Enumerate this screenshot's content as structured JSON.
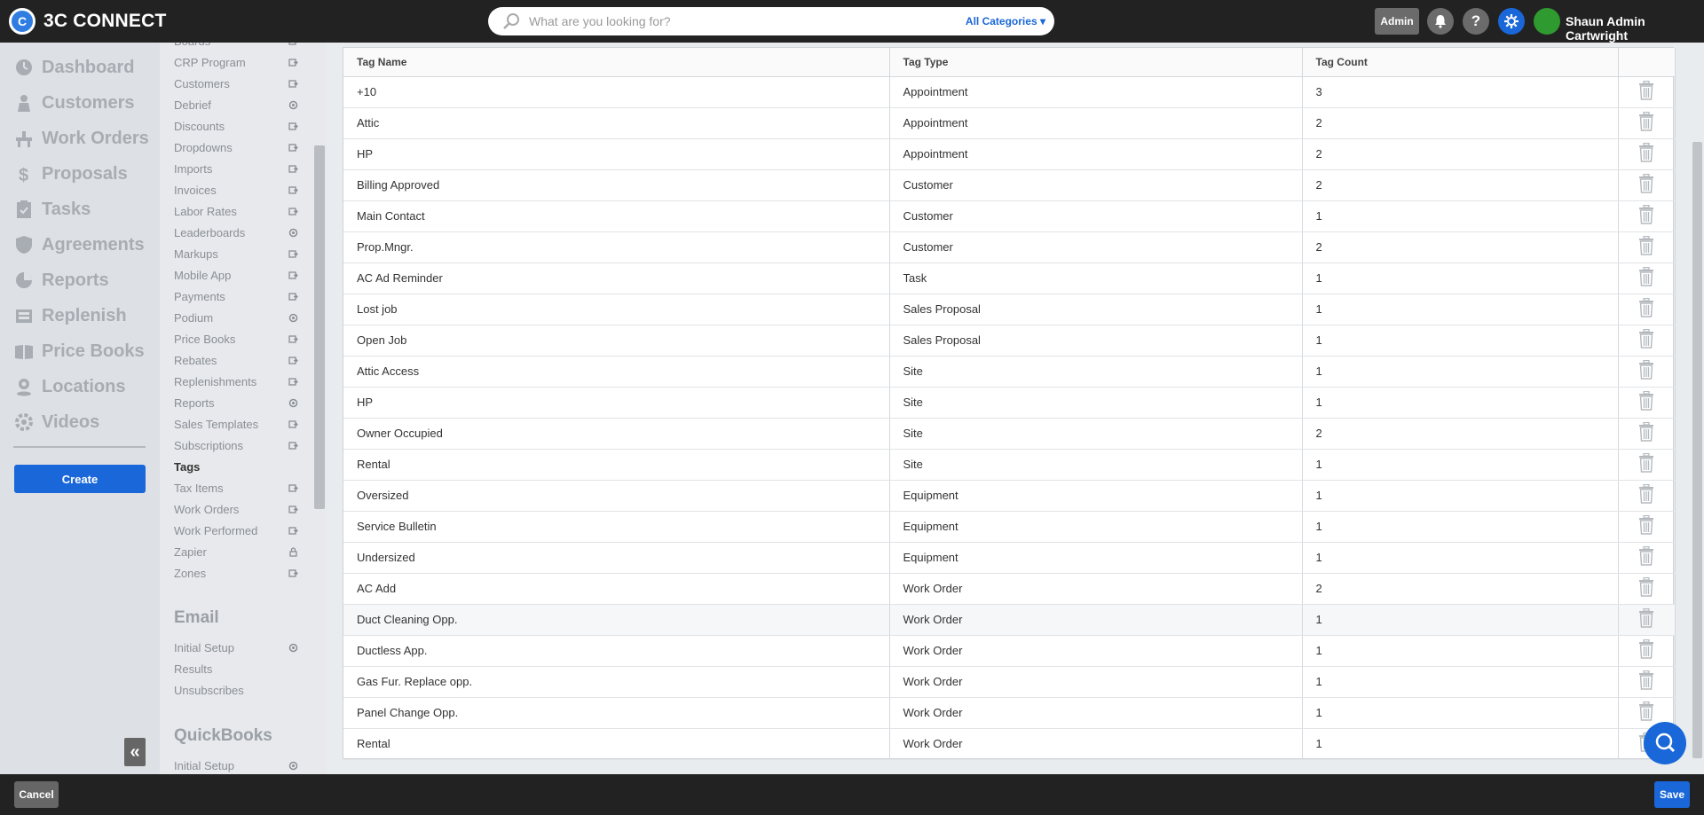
{
  "app": {
    "name": "3C CONNECT"
  },
  "search": {
    "placeholder": "What are you looking for?",
    "category": "All Categories"
  },
  "header": {
    "admin_label": "Admin",
    "help_label": "?",
    "user_name": "Shaun Admin Cartwright"
  },
  "nav": {
    "items": [
      {
        "label": "Dashboard",
        "icon": "dashboard-icon"
      },
      {
        "label": "Customers",
        "icon": "customers-icon"
      },
      {
        "label": "Work Orders",
        "icon": "work-orders-icon"
      },
      {
        "label": "Proposals",
        "icon": "proposals-icon"
      },
      {
        "label": "Tasks",
        "icon": "tasks-icon"
      },
      {
        "label": "Agreements",
        "icon": "agreements-icon"
      },
      {
        "label": "Reports",
        "icon": "reports-icon"
      },
      {
        "label": "Replenish",
        "icon": "replenish-icon"
      },
      {
        "label": "Price Books",
        "icon": "price-books-icon"
      },
      {
        "label": "Locations",
        "icon": "locations-icon"
      },
      {
        "label": "Videos",
        "icon": "videos-icon"
      }
    ],
    "create_label": "Create"
  },
  "subnav": {
    "items": [
      "Boards",
      "CRP Program",
      "Customers",
      "Debrief",
      "Discounts",
      "Dropdowns",
      "Imports",
      "Invoices",
      "Labor Rates",
      "Leaderboards",
      "Markups",
      "Mobile App",
      "Payments",
      "Podium",
      "Price Books",
      "Rebates",
      "Replenishments",
      "Reports",
      "Sales Templates",
      "Subscriptions",
      "Tags",
      "Tax Items",
      "Work Orders",
      "Work Performed",
      "Zapier",
      "Zones"
    ],
    "active": "Tags",
    "email_heading": "Email",
    "email_items": [
      "Initial Setup",
      "Results",
      "Unsubscribes"
    ],
    "quickbooks_heading": "QuickBooks",
    "quickbooks_items": [
      "Initial Setup"
    ]
  },
  "table": {
    "headers": [
      "Tag Name",
      "Tag Type",
      "Tag Count"
    ],
    "rows": [
      [
        "+10",
        "Appointment",
        "3"
      ],
      [
        "Attic",
        "Appointment",
        "2"
      ],
      [
        "HP",
        "Appointment",
        "2"
      ],
      [
        "Billing Approved",
        "Customer",
        "2"
      ],
      [
        "Main Contact",
        "Customer",
        "1"
      ],
      [
        "Prop.Mngr.",
        "Customer",
        "2"
      ],
      [
        "AC Ad Reminder",
        "Task",
        "1"
      ],
      [
        "Lost job",
        "Sales Proposal",
        "1"
      ],
      [
        "Open Job",
        "Sales Proposal",
        "1"
      ],
      [
        "Attic Access",
        "Site",
        "1"
      ],
      [
        "HP",
        "Site",
        "1"
      ],
      [
        "Owner Occupied",
        "Site",
        "2"
      ],
      [
        "Rental",
        "Site",
        "1"
      ],
      [
        "Oversized",
        "Equipment",
        "1"
      ],
      [
        "Service Bulletin",
        "Equipment",
        "1"
      ],
      [
        "Undersized",
        "Equipment",
        "1"
      ],
      [
        "AC Add",
        "Work Order",
        "2"
      ],
      [
        "Duct Cleaning Opp.",
        "Work Order",
        "1"
      ],
      [
        "Ductless App.",
        "Work Order",
        "1"
      ],
      [
        "Gas Fur. Replace opp.",
        "Work Order",
        "1"
      ],
      [
        "Panel Change Opp.",
        "Work Order",
        "1"
      ],
      [
        "Rental",
        "Work Order",
        "1"
      ]
    ]
  },
  "footer": {
    "cancel_label": "Cancel",
    "save_label": "Save"
  },
  "colors": {
    "accent": "#1a67d9",
    "topbar": "#222222",
    "nav_text": "#a8adb3"
  }
}
